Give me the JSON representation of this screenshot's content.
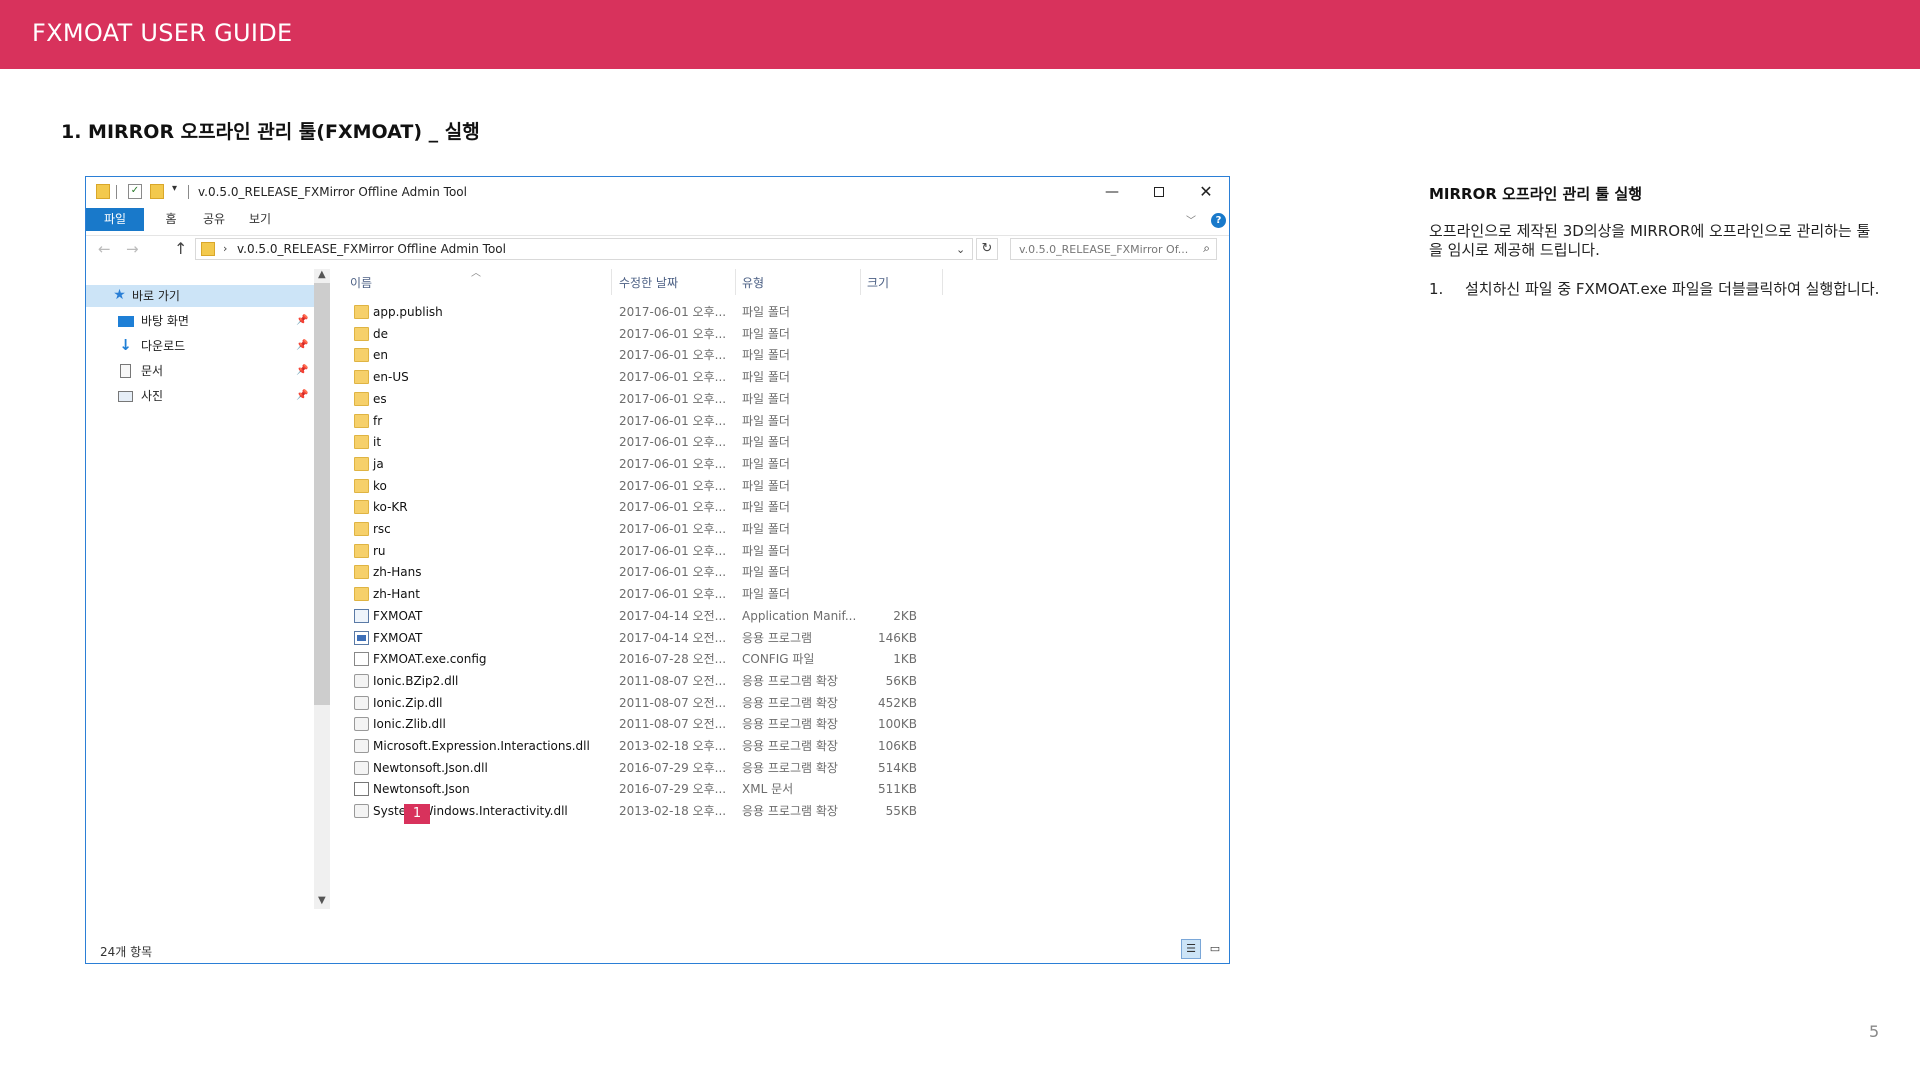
{
  "header": {
    "title": "FXMOAT USER GUIDE"
  },
  "section": {
    "title": "1. MIRROR 오프라인 관리 툴(FXMOAT) _ 실행"
  },
  "explorer": {
    "window_title": "v.0.5.0_RELEASE_FXMirror Offline Admin Tool",
    "ribbon_tabs": [
      "파일",
      "홈",
      "공유",
      "보기"
    ],
    "address_path": "v.0.5.0_RELEASE_FXMirror Offline Admin Tool",
    "search_placeholder": "v.0.5.0_RELEASE_FXMirror Of...",
    "nav_items": [
      {
        "label": "바로 가기",
        "icon": "star-icon",
        "pinned": false
      },
      {
        "label": "바탕 화면",
        "icon": "desktop-icon",
        "pinned": true
      },
      {
        "label": "다운로드",
        "icon": "download-icon",
        "pinned": true
      },
      {
        "label": "문서",
        "icon": "document-icon",
        "pinned": true
      },
      {
        "label": "사진",
        "icon": "picture-icon",
        "pinned": true
      }
    ],
    "columns": {
      "name": "이름",
      "date": "수정한 날짜",
      "type": "유형",
      "size": "크기"
    },
    "files": [
      {
        "name": "app.publish",
        "date": "2017-06-01 오후...",
        "type": "파일 폴더",
        "size": "",
        "icon": "folder"
      },
      {
        "name": "de",
        "date": "2017-06-01 오후...",
        "type": "파일 폴더",
        "size": "",
        "icon": "folder"
      },
      {
        "name": "en",
        "date": "2017-06-01 오후...",
        "type": "파일 폴더",
        "size": "",
        "icon": "folder"
      },
      {
        "name": "en-US",
        "date": "2017-06-01 오후...",
        "type": "파일 폴더",
        "size": "",
        "icon": "folder"
      },
      {
        "name": "es",
        "date": "2017-06-01 오후...",
        "type": "파일 폴더",
        "size": "",
        "icon": "folder"
      },
      {
        "name": "fr",
        "date": "2017-06-01 오후...",
        "type": "파일 폴더",
        "size": "",
        "icon": "folder"
      },
      {
        "name": "it",
        "date": "2017-06-01 오후...",
        "type": "파일 폴더",
        "size": "",
        "icon": "folder"
      },
      {
        "name": "ja",
        "date": "2017-06-01 오후...",
        "type": "파일 폴더",
        "size": "",
        "icon": "folder"
      },
      {
        "name": "ko",
        "date": "2017-06-01 오후...",
        "type": "파일 폴더",
        "size": "",
        "icon": "folder"
      },
      {
        "name": "ko-KR",
        "date": "2017-06-01 오후...",
        "type": "파일 폴더",
        "size": "",
        "icon": "folder"
      },
      {
        "name": "rsc",
        "date": "2017-06-01 오후...",
        "type": "파일 폴더",
        "size": "",
        "icon": "folder"
      },
      {
        "name": "ru",
        "date": "2017-06-01 오후...",
        "type": "파일 폴더",
        "size": "",
        "icon": "folder"
      },
      {
        "name": "zh-Hans",
        "date": "2017-06-01 오후...",
        "type": "파일 폴더",
        "size": "",
        "icon": "folder"
      },
      {
        "name": "zh-Hant",
        "date": "2017-06-01 오후...",
        "type": "파일 폴더",
        "size": "",
        "icon": "folder"
      },
      {
        "name": "FXMOAT",
        "date": "2017-04-14 오전...",
        "type": "Application Manif...",
        "size": "2KB",
        "icon": "manifest"
      },
      {
        "name": "FXMOAT",
        "date": "2017-04-14 오전...",
        "type": "응용 프로그램",
        "size": "146KB",
        "icon": "app"
      },
      {
        "name": "FXMOAT.exe.config",
        "date": "2016-07-28 오전...",
        "type": "CONFIG 파일",
        "size": "1KB",
        "icon": "doc"
      },
      {
        "name": "Ionic.BZip2.dll",
        "date": "2011-08-07 오전...",
        "type": "응용 프로그램 확장",
        "size": "56KB",
        "icon": "dll"
      },
      {
        "name": "Ionic.Zip.dll",
        "date": "2011-08-07 오전...",
        "type": "응용 프로그램 확장",
        "size": "452KB",
        "icon": "dll"
      },
      {
        "name": "Ionic.Zlib.dll",
        "date": "2011-08-07 오전...",
        "type": "응용 프로그램 확장",
        "size": "100KB",
        "icon": "dll"
      },
      {
        "name": "Microsoft.Expression.Interactions.dll",
        "date": "2013-02-18 오후...",
        "type": "응용 프로그램 확장",
        "size": "106KB",
        "icon": "dll"
      },
      {
        "name": "Newtonsoft.Json.dll",
        "date": "2016-07-29 오후...",
        "type": "응용 프로그램 확장",
        "size": "514KB",
        "icon": "dll"
      },
      {
        "name": "Newtonsoft.Json",
        "date": "2016-07-29 오후...",
        "type": "XML 문서",
        "size": "511KB",
        "icon": "xml"
      },
      {
        "name": "System.Windows.Interactivity.dll",
        "date": "2013-02-18 오후...",
        "type": "응용 프로그램 확장",
        "size": "55KB",
        "icon": "dll"
      }
    ],
    "marker_label": "1",
    "status_text": "24개 항목"
  },
  "description": {
    "heading": "MIRROR 오프라인 관리 툴 실행",
    "intro": "오프라인으로 제작된 3D의상을 MIRROR에 오프라인으로 관리하는 툴을 임시로 제공해 드립니다.",
    "step_number": "1.",
    "step_text": "설치하신 파일 중 FXMOAT.exe 파일을 더블클릭하여 실행합니다."
  },
  "page_number": "5",
  "colors": {
    "accent": "#d8325c",
    "window_border": "#2b7fd6",
    "ribbon_file": "#1979ca"
  }
}
